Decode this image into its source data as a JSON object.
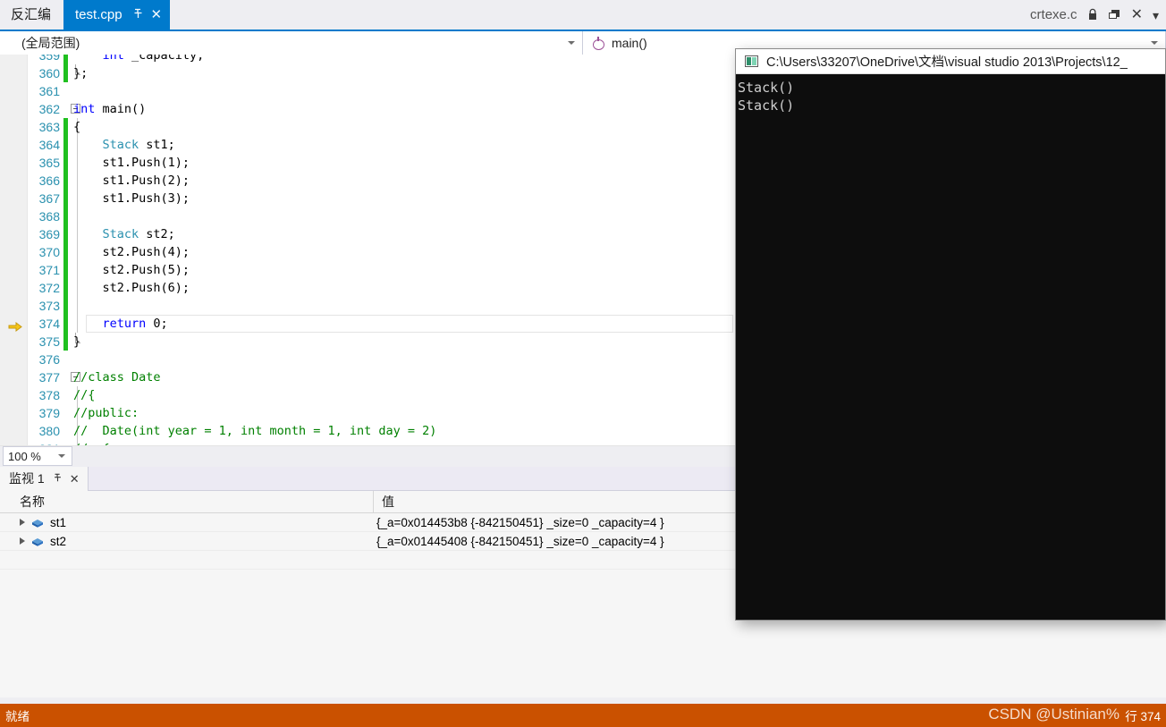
{
  "tabstrip": {
    "inactive_tab": "反汇编",
    "active_tab": "test.cpp",
    "pin_icon": "pin-icon",
    "close_icon": "✕",
    "right_filename": "crtexe.c",
    "lock_icon": "🔒",
    "restore_icon": "❏",
    "close_window_icon": "✕",
    "dropdown_icon": "▾"
  },
  "navbar": {
    "scope": "(全局范围)",
    "member": "main()",
    "member_icon": "method-icon"
  },
  "editor": {
    "zoom_level": "100 %",
    "current_line": 374,
    "lines": [
      {
        "n": 359,
        "text": "    int _capacity;",
        "bar": true,
        "clipped_top": true,
        "tokens": [
          {
            "t": "    ",
            "c": ""
          },
          {
            "t": "int",
            "c": "kw"
          },
          {
            "t": " _capacity;",
            "c": ""
          }
        ]
      },
      {
        "n": 360,
        "text": "};",
        "bar": true,
        "fold_end": true,
        "tokens": [
          {
            "t": "};",
            "c": ""
          }
        ]
      },
      {
        "n": 361,
        "text": "",
        "bar": false,
        "tokens": []
      },
      {
        "n": 362,
        "text": "int main()",
        "bar": false,
        "fold": true,
        "tokens": [
          {
            "t": "int",
            "c": "kw"
          },
          {
            "t": " main()",
            "c": ""
          }
        ]
      },
      {
        "n": 363,
        "text": "{",
        "bar": true,
        "guide": true,
        "tokens": [
          {
            "t": "{",
            "c": ""
          }
        ]
      },
      {
        "n": 364,
        "text": "    Stack st1;",
        "bar": true,
        "guide": true,
        "tokens": [
          {
            "t": "    ",
            "c": ""
          },
          {
            "t": "Stack",
            "c": "typ"
          },
          {
            "t": " st1;",
            "c": ""
          }
        ]
      },
      {
        "n": 365,
        "text": "    st1.Push(1);",
        "bar": true,
        "guide": true,
        "tokens": [
          {
            "t": "    st1.Push(1);",
            "c": ""
          }
        ]
      },
      {
        "n": 366,
        "text": "    st1.Push(2);",
        "bar": true,
        "guide": true,
        "tokens": [
          {
            "t": "    st1.Push(2);",
            "c": ""
          }
        ]
      },
      {
        "n": 367,
        "text": "    st1.Push(3);",
        "bar": true,
        "guide": true,
        "tokens": [
          {
            "t": "    st1.Push(3);",
            "c": ""
          }
        ]
      },
      {
        "n": 368,
        "text": "",
        "bar": true,
        "guide": true,
        "tokens": []
      },
      {
        "n": 369,
        "text": "    Stack st2;",
        "bar": true,
        "guide": true,
        "tokens": [
          {
            "t": "    ",
            "c": ""
          },
          {
            "t": "Stack",
            "c": "typ"
          },
          {
            "t": " st2;",
            "c": ""
          }
        ]
      },
      {
        "n": 370,
        "text": "    st2.Push(4);",
        "bar": true,
        "guide": true,
        "tokens": [
          {
            "t": "    st2.Push(4);",
            "c": ""
          }
        ]
      },
      {
        "n": 371,
        "text": "    st2.Push(5);",
        "bar": true,
        "guide": true,
        "tokens": [
          {
            "t": "    st2.Push(5);",
            "c": ""
          }
        ]
      },
      {
        "n": 372,
        "text": "    st2.Push(6);",
        "bar": true,
        "guide": true,
        "tokens": [
          {
            "t": "    st2.Push(6);",
            "c": ""
          }
        ]
      },
      {
        "n": 373,
        "text": "",
        "bar": true,
        "guide": true,
        "tokens": []
      },
      {
        "n": 374,
        "text": "    return 0;",
        "bar": true,
        "guide": true,
        "current": true,
        "tokens": [
          {
            "t": "    ",
            "c": ""
          },
          {
            "t": "return",
            "c": "kw"
          },
          {
            "t": " 0;",
            "c": ""
          }
        ]
      },
      {
        "n": 375,
        "text": "}",
        "bar": true,
        "fold_end": true,
        "tokens": [
          {
            "t": "}",
            "c": ""
          }
        ]
      },
      {
        "n": 376,
        "text": "",
        "bar": false,
        "tokens": []
      },
      {
        "n": 377,
        "text": "//class Date",
        "bar": false,
        "fold": true,
        "tokens": [
          {
            "t": "//class Date",
            "c": "cmt"
          }
        ]
      },
      {
        "n": 378,
        "text": "//{",
        "bar": false,
        "guide": true,
        "tokens": [
          {
            "t": "//{",
            "c": "cmt"
          }
        ]
      },
      {
        "n": 379,
        "text": "//public:",
        "bar": false,
        "guide": true,
        "tokens": [
          {
            "t": "//public:",
            "c": "cmt"
          }
        ]
      },
      {
        "n": 380,
        "text": "//  Date(int year = 1, int month = 1, int day = 2)",
        "bar": false,
        "guide": true,
        "tokens": [
          {
            "t": "//  Date(",
            "c": "cmt"
          },
          {
            "t": "int",
            "c": "cmt"
          },
          {
            "t": " year = 1, ",
            "c": "cmt"
          },
          {
            "t": "int",
            "c": "cmt"
          },
          {
            "t": " month = 1, ",
            "c": "cmt"
          },
          {
            "t": "int",
            "c": "cmt"
          },
          {
            "t": " day = 2)",
            "c": "cmt"
          }
        ]
      },
      {
        "n": 381,
        "text": "//  {",
        "bar": false,
        "guide": true,
        "clipped_bottom": true,
        "tokens": [
          {
            "t": "//  {",
            "c": "cmt"
          }
        ]
      }
    ]
  },
  "watch": {
    "tab_label": "监视 1",
    "pin_icon": "pin-icon",
    "close_icon": "✕",
    "columns": [
      "名称",
      "值"
    ],
    "rows": [
      {
        "name": "st1",
        "value": "{_a=0x014453b8 {-842150451} _size=0 _capacity=4 }"
      },
      {
        "name": "st2",
        "value": "{_a=0x01445408 {-842150451} _size=0 _capacity=4 }"
      }
    ]
  },
  "console": {
    "title": "C:\\Users\\33207\\OneDrive\\文档\\visual studio 2013\\Projects\\12_",
    "lines": [
      "Stack()",
      "Stack()"
    ]
  },
  "statusbar": {
    "left": "就绪",
    "right": "行 374",
    "watermark": "CSDN @Ustinian%"
  },
  "colors": {
    "accent_blue": "#007acc",
    "status_orange": "#ca5100",
    "change_bar_green": "#20c020",
    "keyword_blue": "#0000ff",
    "type_teal": "#2b91af",
    "comment_green": "#008000",
    "console_bg": "#0d0d0d"
  }
}
